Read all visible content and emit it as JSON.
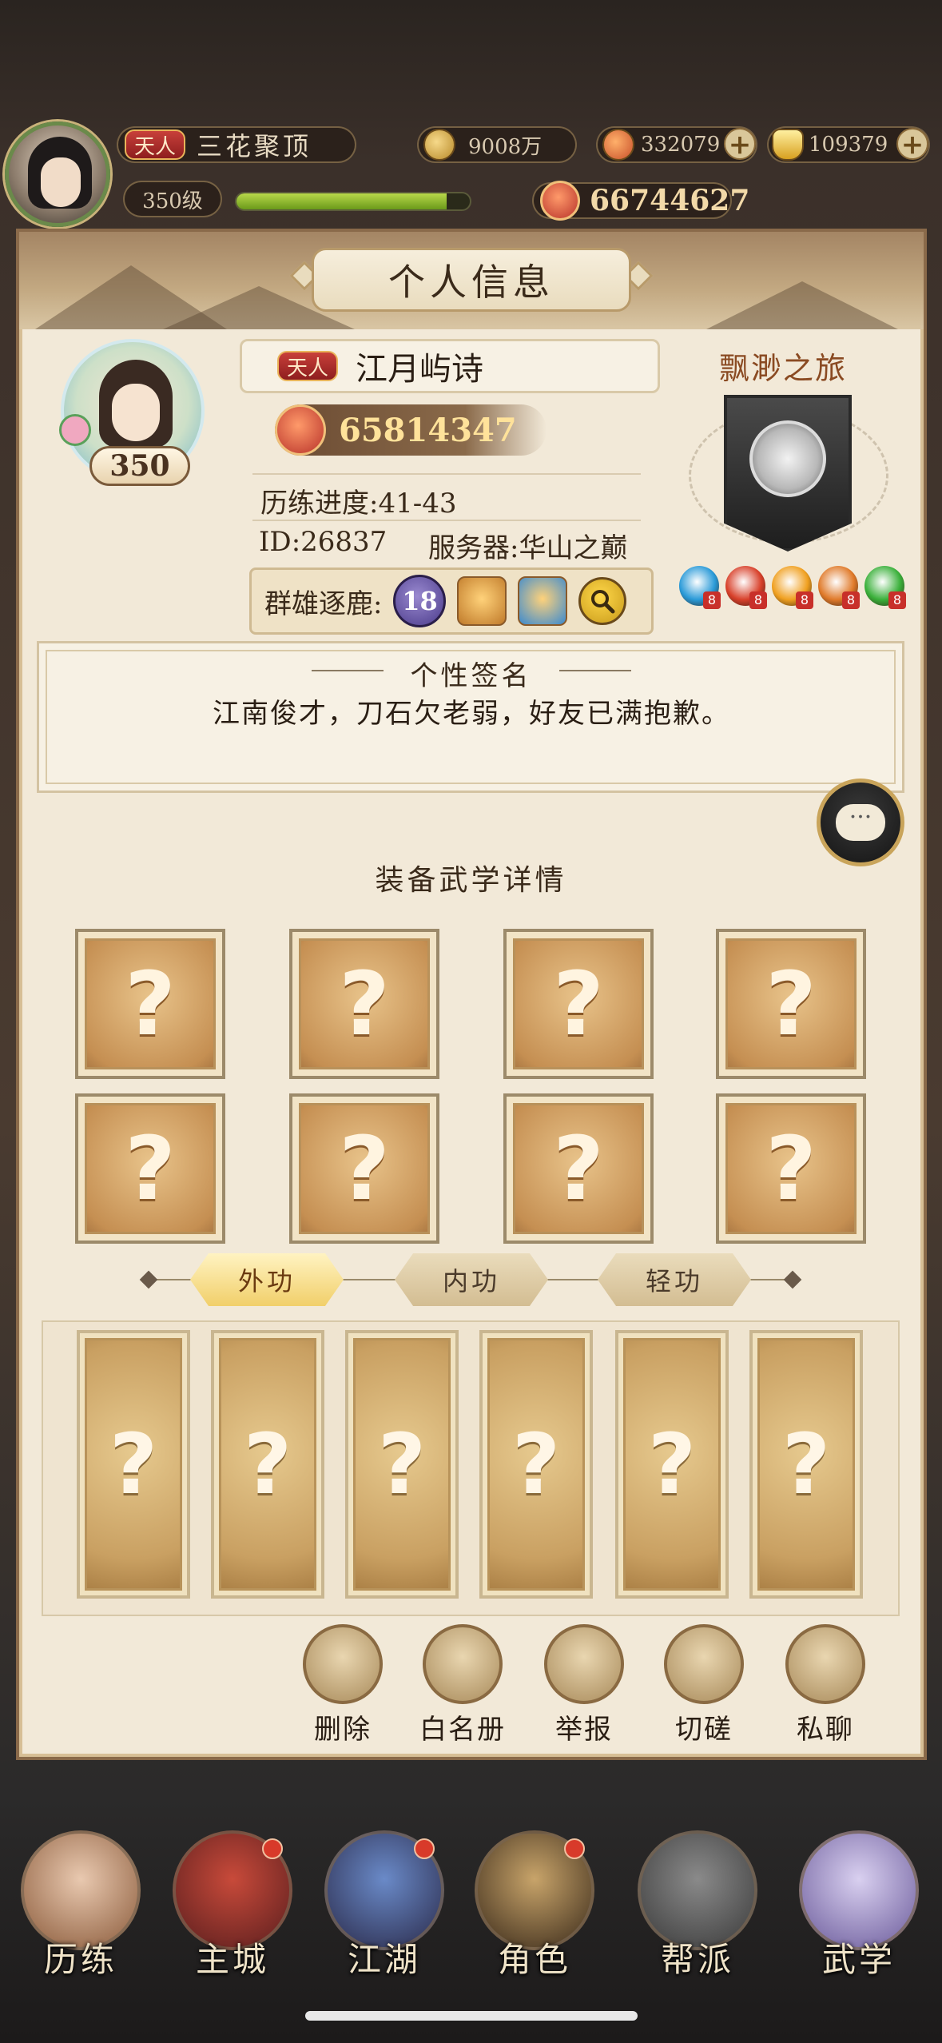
{
  "hud": {
    "rank_tag": "天人",
    "realm": "三花聚顶",
    "level": "350级",
    "exp_fraction": 0.9,
    "coins": "9008万",
    "currency2": "332079",
    "ingots": "109379",
    "power": "66744627"
  },
  "panel": {
    "title": "个人信息"
  },
  "profile": {
    "level": "350",
    "rank_tag": "天人",
    "name": "江月屿诗",
    "power": "65814347",
    "progress": "历练进度:41-43",
    "id": "ID:26837",
    "server": "服务器:华山之巅",
    "contest_label": "群雄逐鹿:",
    "contest_badge": "18",
    "journey_title": "飘渺之旅",
    "orbs": [
      {
        "num": "8",
        "color": "#2a9ad8"
      },
      {
        "num": "8",
        "color": "#d8402a"
      },
      {
        "num": "8",
        "color": "#f0a020"
      },
      {
        "num": "8",
        "color": "#e07a2a"
      },
      {
        "num": "8",
        "color": "#3ab03a"
      }
    ]
  },
  "signature": {
    "title": "个性签名",
    "text": "江南俊才，刀石欠老弱，好友已满抱歉。"
  },
  "equipment": {
    "title": "装备武学详情",
    "slot_mark": "?",
    "tabs": [
      "外功",
      "内功",
      "轻功"
    ],
    "card_mark": "?"
  },
  "actions": [
    "删除",
    "白名册",
    "举报",
    "切磋",
    "私聊"
  ],
  "chat_icon_text": "···",
  "nav": [
    "历练",
    "主城",
    "江湖",
    "角色",
    "帮派",
    "武学"
  ]
}
